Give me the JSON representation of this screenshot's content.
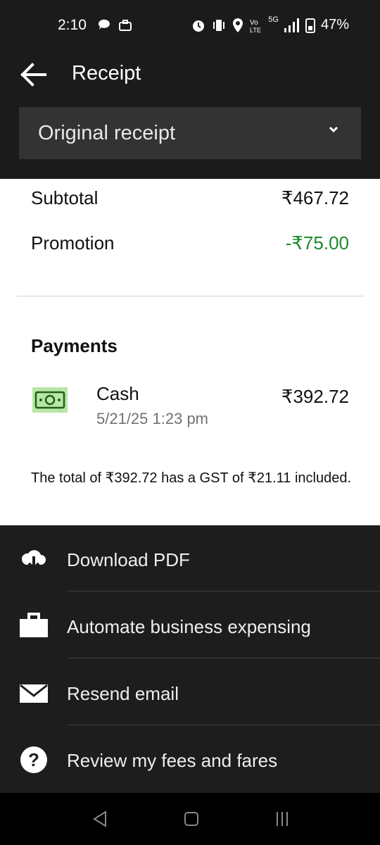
{
  "status_bar": {
    "time": "2:10",
    "battery_percent": "47%",
    "network_label": "5G"
  },
  "header": {
    "title": "Receipt"
  },
  "receipt_select": {
    "value": "Original receipt"
  },
  "summary": {
    "subtotal_label": "Subtotal",
    "subtotal_value": "₹467.72",
    "promotion_label": "Promotion",
    "promotion_value": "-₹75.00",
    "promotion_color": "#1e8a30"
  },
  "payments": {
    "title": "Payments",
    "method": "Cash",
    "date": "5/21/25 1:23 pm",
    "amount": "₹392.72"
  },
  "gst_note": "The total of ₹392.72 has a GST of ₹21.11 included.",
  "actions": [
    {
      "label": "Download PDF",
      "icon": "cloud-download-icon"
    },
    {
      "label": "Automate business expensing",
      "icon": "briefcase-icon"
    },
    {
      "label": "Resend email",
      "icon": "envelope-icon"
    },
    {
      "label": "Review my fees and fares",
      "icon": "help-circle-icon"
    }
  ]
}
